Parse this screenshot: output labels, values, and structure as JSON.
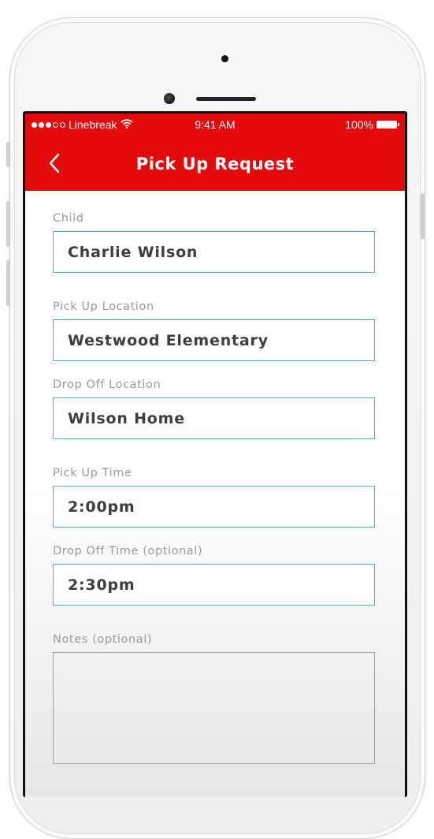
{
  "status_bar": {
    "carrier": "Linebreak",
    "time": "9:41 AM",
    "battery": "100%"
  },
  "header": {
    "title": "Pick Up Request",
    "back_icon": "chevron-left-icon"
  },
  "form": {
    "child": {
      "label": "Child",
      "value": "Charlie Wilson"
    },
    "pickup_location": {
      "label": "Pick Up Location",
      "value": "Westwood Elementary"
    },
    "dropoff_location": {
      "label": "Drop Off Location",
      "value": "Wilson Home"
    },
    "pickup_time": {
      "label": "Pick Up Time",
      "value": "2:00pm"
    },
    "dropoff_time": {
      "label": "Drop Off Time (optional)",
      "value": "2:30pm"
    },
    "notes": {
      "label": "Notes (optional)",
      "value": ""
    }
  },
  "colors": {
    "accent_red": "#e20a0a",
    "field_border": "#41b7d6"
  }
}
